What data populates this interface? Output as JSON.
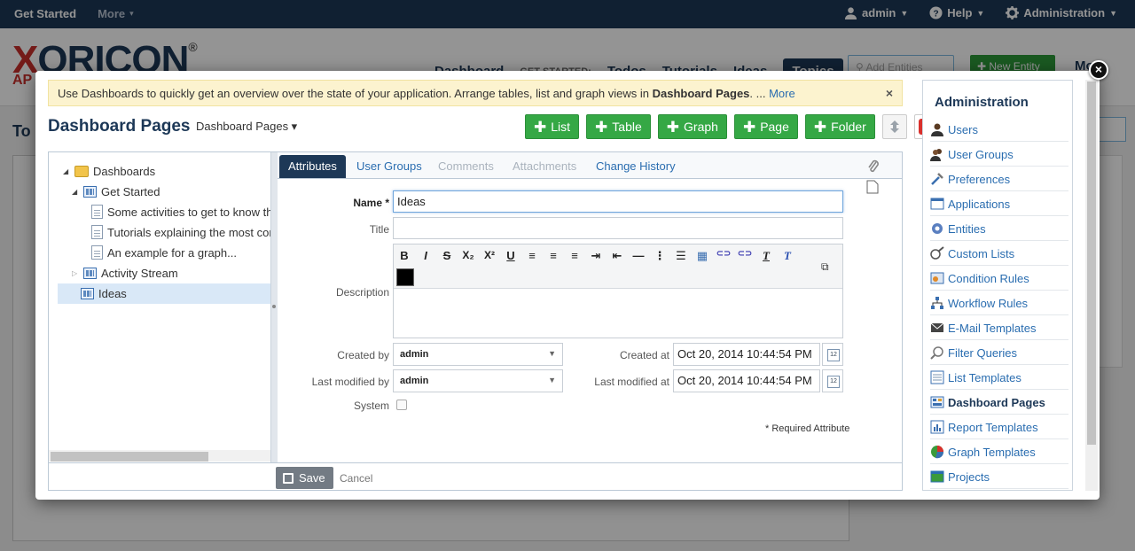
{
  "topbar": {
    "get_started": "Get Started",
    "more": "More",
    "user": "admin",
    "help": "Help",
    "administration": "Administration"
  },
  "background": {
    "logo": "XORICON",
    "logo_reg": "®",
    "logo_sub": "AP",
    "nav": {
      "dashboard": "Dashboard",
      "get_started_label": "GET STARTED:",
      "todos": "Todos",
      "tutorials": "Tutorials",
      "ideas": "Ideas",
      "topics": "Topics"
    },
    "search_placeholder": "Add Entities",
    "new_entity": "New Entity",
    "more": "Mo",
    "left_title": "To"
  },
  "modal": {
    "info_text": "Use Dashboards to quickly get an overview over the state of your application. Arrange tables, list and graph views in ",
    "info_bold": "Dashboard Pages",
    "info_after": ". ... ",
    "info_more": "More",
    "info_close": "×",
    "title": "Dashboard Pages",
    "subtitle": "Dashboard Pages ▾",
    "actions": {
      "list": "List",
      "table": "Table",
      "graph": "Graph",
      "page": "Page",
      "folder": "Folder"
    },
    "tree": [
      {
        "label": "Dashboards"
      },
      {
        "label": "Get Started"
      },
      {
        "label": "Some activities to get to know th"
      },
      {
        "label": "Tutorials explaining the most cor"
      },
      {
        "label": "An example for a graph..."
      },
      {
        "label": "Activity Stream"
      },
      {
        "label": "Ideas"
      }
    ],
    "tabs": {
      "attributes": "Attributes",
      "user_groups": "User Groups",
      "comments": "Comments",
      "attachments": "Attachments",
      "change_history": "Change History"
    },
    "form": {
      "name_label": "Name *",
      "name_value": "Ideas",
      "title_label": "Title",
      "title_value": "",
      "description_label": "Description",
      "created_by_label": "Created by",
      "created_by_value": "admin",
      "modified_by_label": "Last modified by",
      "modified_by_value": "admin",
      "created_at_label": "Created at",
      "created_at_value": "Oct 20, 2014 10:44:54 PM",
      "modified_at_label": "Last modified at",
      "modified_at_value": "Oct 20, 2014 10:44:54 PM",
      "system_label": "System",
      "required_note": "* Required Attribute"
    },
    "editor_buttons": [
      "B",
      "I",
      "S",
      "X₂",
      "X²",
      "U",
      "≡",
      "≡",
      "≡",
      "⇥",
      "⇤",
      "—",
      "⋮",
      "☰",
      "▦",
      "⊂⊃",
      "⊂⊃",
      "T",
      "T"
    ],
    "footer": {
      "save": "Save",
      "cancel": "Cancel"
    },
    "close": "×"
  },
  "admin_panel": {
    "title": "Administration",
    "items": [
      {
        "label": "Users",
        "icon": "user-icon",
        "active": false
      },
      {
        "label": "User Groups",
        "icon": "user-group-icon",
        "active": false
      },
      {
        "label": "Preferences",
        "icon": "preferences-icon",
        "active": false
      },
      {
        "label": "Applications",
        "icon": "application-icon",
        "active": false
      },
      {
        "label": "Entities",
        "icon": "entity-icon",
        "active": false
      },
      {
        "label": "Custom Lists",
        "icon": "custom-list-icon",
        "active": false
      },
      {
        "label": "Condition Rules",
        "icon": "condition-rule-icon",
        "active": false
      },
      {
        "label": "Workflow Rules",
        "icon": "workflow-icon",
        "active": false
      },
      {
        "label": "E-Mail Templates",
        "icon": "email-icon",
        "active": false
      },
      {
        "label": "Filter Queries",
        "icon": "filter-icon",
        "active": false
      },
      {
        "label": "List Templates",
        "icon": "list-template-icon",
        "active": false
      },
      {
        "label": "Dashboard Pages",
        "icon": "dashboard-icon",
        "active": true
      },
      {
        "label": "Report Templates",
        "icon": "report-icon",
        "active": false
      },
      {
        "label": "Graph Templates",
        "icon": "pie-chart-icon",
        "active": false
      },
      {
        "label": "Projects",
        "icon": "project-icon",
        "active": false
      }
    ]
  }
}
